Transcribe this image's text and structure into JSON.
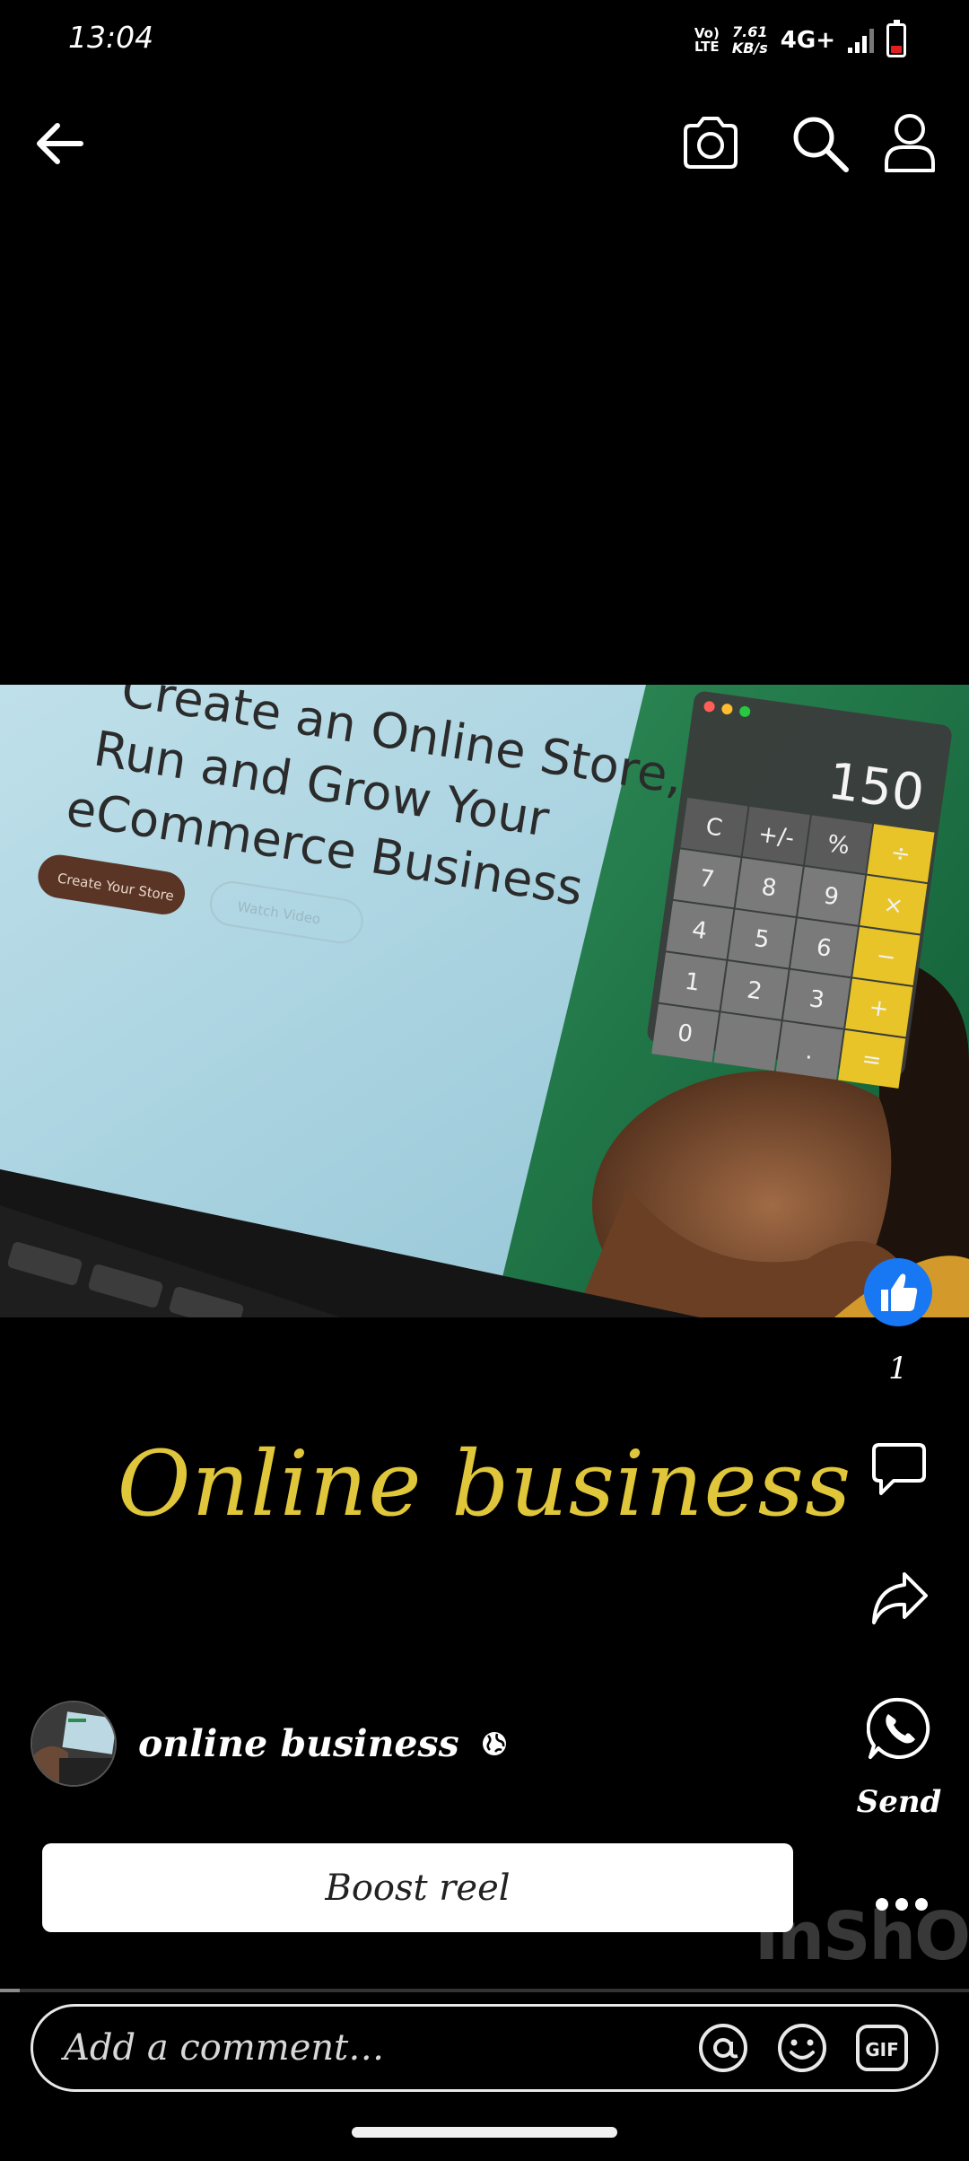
{
  "status_bar": {
    "time": "13:04",
    "volte": "Vo) LTE",
    "net_speed_value": "7.61",
    "net_speed_unit": "KB/s",
    "network": "4G+",
    "battery_level": 0.25
  },
  "top_bar": {
    "icons": [
      "back-arrow-icon",
      "camera-icon",
      "search-icon",
      "profile-icon"
    ]
  },
  "video": {
    "headline_lines": [
      "Create an Online Store,",
      "Run and Grow Your",
      "eCommerce Business"
    ],
    "primary_button": "Create Your Store",
    "secondary_button": "Watch Video",
    "calculator_display": "150",
    "calculator_keys": [
      [
        "C",
        "+/-",
        "%",
        "÷"
      ],
      [
        "7",
        "8",
        "9",
        "×"
      ],
      [
        "4",
        "5",
        "6",
        "−"
      ],
      [
        "1",
        "2",
        "3",
        "+"
      ],
      [
        "0",
        "",
        ".",
        "="
      ]
    ],
    "overlay_title": "Online business",
    "watermark": "InShO"
  },
  "actions": {
    "like_count": "1",
    "send_label": "Send",
    "colors": {
      "like_blue": "#1877F2",
      "accent_yellow": "#E0C63A"
    }
  },
  "author": {
    "name": "online business",
    "privacy_icon": "globe-icon"
  },
  "boost_button": "Boost reel",
  "playback_progress": 0.02,
  "comment": {
    "placeholder": "Add a comment…"
  }
}
